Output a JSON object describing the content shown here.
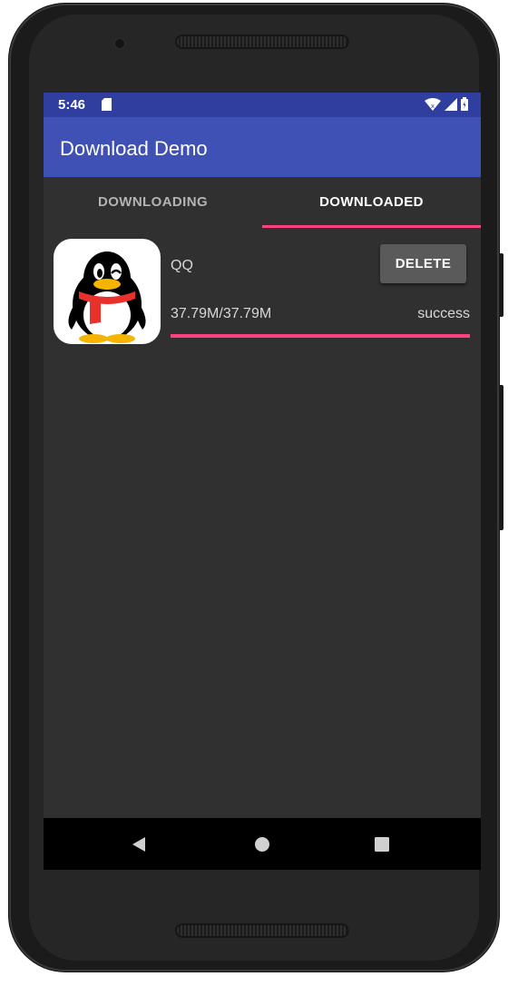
{
  "status_bar": {
    "time": "5:46",
    "icons": [
      "sd-card-icon",
      "wifi-icon",
      "signal-icon",
      "battery-icon"
    ]
  },
  "app_bar": {
    "title": "Download Demo"
  },
  "tabs": [
    {
      "label": "DOWNLOADING",
      "active": false
    },
    {
      "label": "DOWNLOADED",
      "active": true
    }
  ],
  "downloads": [
    {
      "name": "QQ",
      "icon": "qq-penguin-icon",
      "size": "37.79M/37.79M",
      "status": "success",
      "progress": 1.0,
      "delete_label": "DELETE"
    }
  ],
  "nav_bar": {
    "buttons": [
      "back-icon",
      "home-icon",
      "recents-icon"
    ]
  },
  "colors": {
    "status_bar": "#303f9f",
    "app_bar": "#3f51b5",
    "accent": "#ff4081",
    "background": "#303030"
  }
}
